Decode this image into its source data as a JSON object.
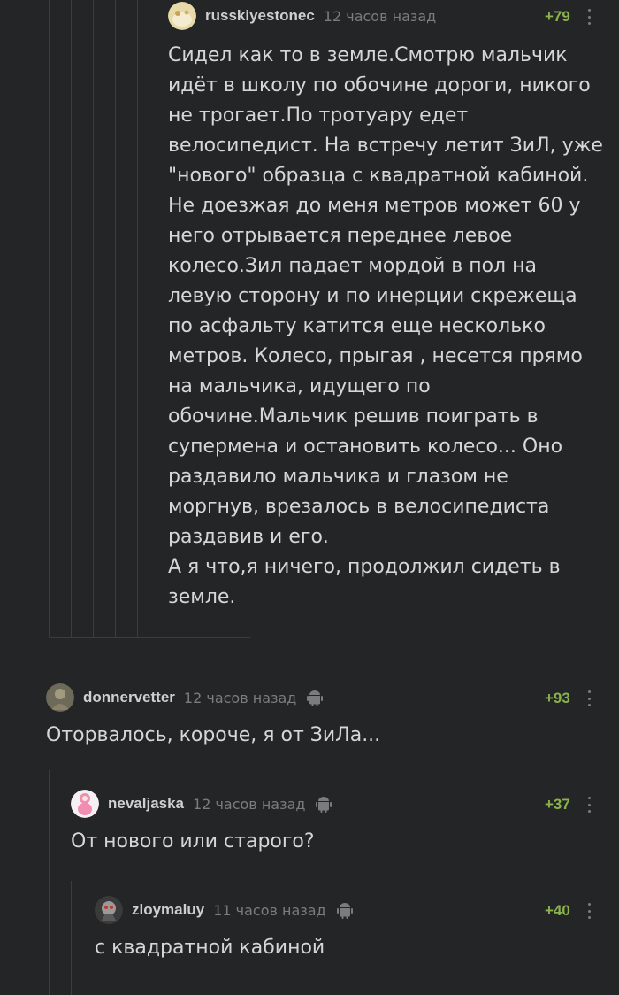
{
  "comments": [
    {
      "username": "russkiyestonec",
      "time": "12 часов назад",
      "rating": "+79",
      "avatar": "avatar-russkiyestonec",
      "text": "Сидел как то в земле.Смотрю мальчик\nидёт в школу по обочине дороги, никого\nне трогает.По тротуару едет\nвелосипедист. На встречу летит ЗиЛ, уже\n\"нового\" образца с квадратной кабиной.\nНе доезжая до меня метров может 60 у\nнего отрывается переднее левое\nколесо.Зил падает мордой в пол на\nлевую сторону и по инерции скрежеща\nпо асфальту катится еще несколько\nметров. Колесо, прыгая , несется прямо\nна мальчика, идущего по\nобочине.Мальчик решив поиграть в\nсупермена и остановить колесо... Оно\nраздавило мальчика и глазом не\nморгнув, врезалось в велосипедиста\nраздавив и его.\nА я что,я ничего, продолжил сидеть в\nземле."
    },
    {
      "username": "donnervetter",
      "time": "12 часов назад",
      "rating": "+93",
      "avatar": "avatar-donnervetter",
      "text": "Оторвалось, короче, я от ЗиЛа..."
    },
    {
      "username": "nevaljaska",
      "time": "12 часов назад",
      "rating": "+37",
      "avatar": "avatar-nevaljaska",
      "text": "От нового или старого?"
    },
    {
      "username": "zloymaluy",
      "time": "11 часов назад",
      "rating": "+40",
      "avatar": "avatar-zloymaluy",
      "text": "с квадратной кабиной"
    }
  ],
  "icons": {
    "platform": "android-icon",
    "menu": "more-vertical-icon"
  },
  "colors": {
    "background": "#242527",
    "rating": "#8ab24d",
    "thread_line": "#3b3c3e",
    "muted": "#7b7c7e",
    "text": "#d6d6d6"
  }
}
